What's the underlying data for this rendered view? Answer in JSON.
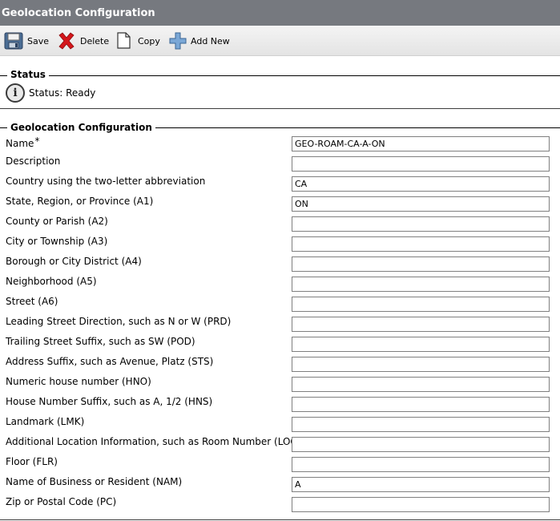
{
  "window": {
    "title": "Geolocation Configuration"
  },
  "toolbar": {
    "save_label": "Save",
    "delete_label": "Delete",
    "copy_label": "Copy",
    "add_new_label": "Add New"
  },
  "status_section": {
    "title": "Status",
    "status_text": "Status: Ready"
  },
  "config_section": {
    "title": "Geolocation Configuration",
    "required_marker": "*",
    "fields": [
      {
        "label": "Name",
        "value": "GEO-ROAM-CA-A-ON"
      },
      {
        "label": "Description",
        "value": ""
      },
      {
        "label": "Country using the two-letter abbreviation",
        "value": "CA"
      },
      {
        "label": "State, Region, or Province (A1)",
        "value": "ON"
      },
      {
        "label": "County or Parish (A2)",
        "value": ""
      },
      {
        "label": "City or Township (A3)",
        "value": ""
      },
      {
        "label": "Borough or City District (A4)",
        "value": ""
      },
      {
        "label": "Neighborhood (A5)",
        "value": ""
      },
      {
        "label": "Street (A6)",
        "value": ""
      },
      {
        "label": "Leading Street Direction, such as N or W (PRD)",
        "value": ""
      },
      {
        "label": "Trailing Street Suffix, such as SW (POD)",
        "value": ""
      },
      {
        "label": "Address Suffix, such as Avenue, Platz (STS)",
        "value": ""
      },
      {
        "label": "Numeric house number (HNO)",
        "value": ""
      },
      {
        "label": "House Number Suffix, such as A, 1/2 (HNS)",
        "value": ""
      },
      {
        "label": "Landmark (LMK)",
        "value": ""
      },
      {
        "label": "Additional Location Information, such as Room Number (LOC)",
        "value": ""
      },
      {
        "label": "Floor (FLR)",
        "value": ""
      },
      {
        "label": "Name of Business or Resident (NAM)",
        "value": "A"
      },
      {
        "label": "Zip or Postal Code (PC)",
        "value": ""
      }
    ]
  }
}
